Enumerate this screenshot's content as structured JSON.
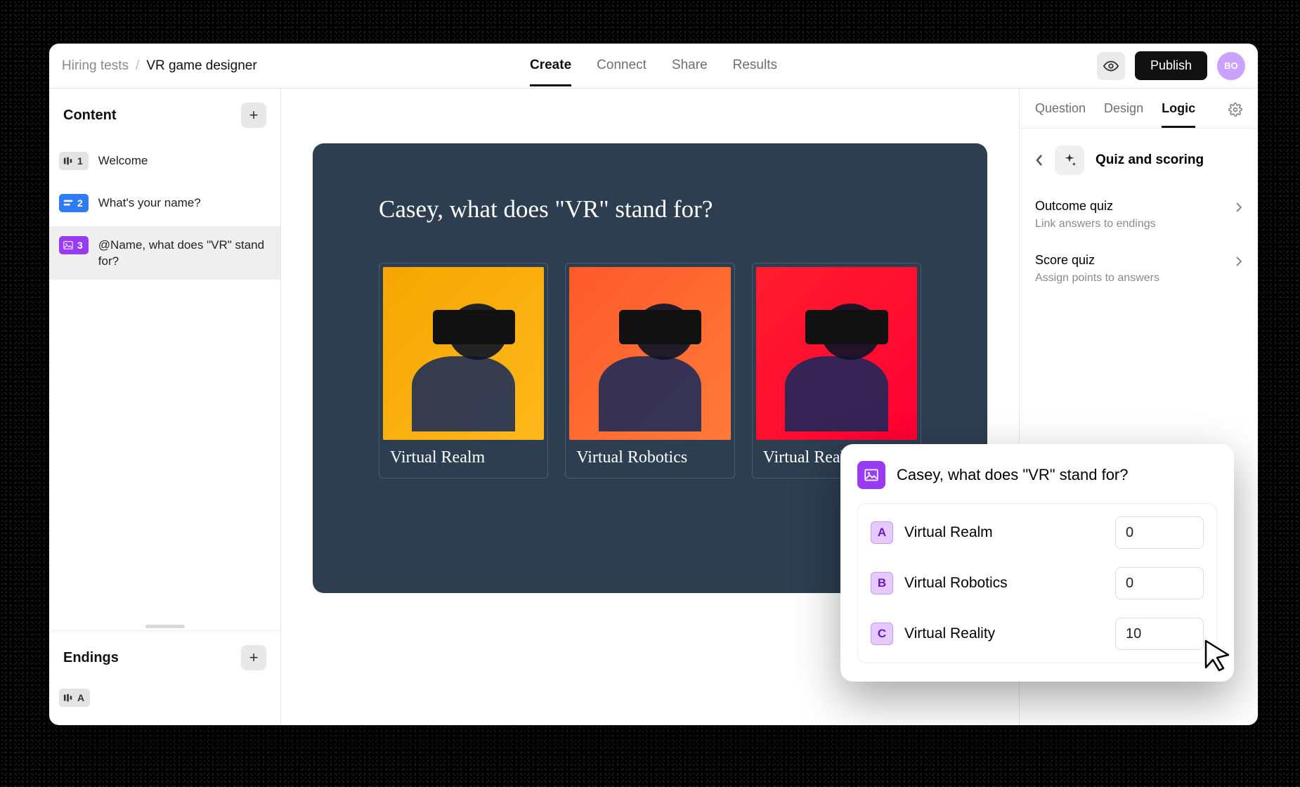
{
  "breadcrumb": {
    "parent": "Hiring tests",
    "current": "VR game designer"
  },
  "header": {
    "tabs": {
      "create": "Create",
      "connect": "Connect",
      "share": "Share",
      "results": "Results"
    },
    "active_tab": "Create",
    "publish": "Publish",
    "avatar_initials": "BO"
  },
  "sidebar": {
    "content_title": "Content",
    "endings_title": "Endings",
    "content": [
      {
        "number": "1",
        "label": "Welcome",
        "style": "gray",
        "icon": "welcome-icon"
      },
      {
        "number": "2",
        "label": "What's your name?",
        "style": "blue",
        "icon": "form-icon"
      },
      {
        "number": "3",
        "label": "@Name, what does \"VR\" stand for?",
        "style": "purple",
        "icon": "picture-icon"
      }
    ],
    "endings": [
      {
        "letter": "A"
      }
    ]
  },
  "canvas": {
    "question": "Casey, what does \"VR\" stand for?",
    "choices": [
      {
        "label": "Virtual Realm",
        "color": "yellow"
      },
      {
        "label": "Virtual Robotics",
        "color": "orange"
      },
      {
        "label": "Virtual Reality",
        "color": "red"
      }
    ]
  },
  "right_panel": {
    "tabs": {
      "question": "Question",
      "design": "Design",
      "logic": "Logic"
    },
    "active_tab": "Logic",
    "quiz_heading": "Quiz and scoring",
    "outcome": {
      "title": "Outcome quiz",
      "sub": "Link answers to endings"
    },
    "score": {
      "title": "Score quiz",
      "sub": "Assign points to answers"
    }
  },
  "popup": {
    "title": "Casey, what does \"VR\" stand for?",
    "answers": [
      {
        "letter": "A",
        "label": "Virtual Realm",
        "score": "0"
      },
      {
        "letter": "B",
        "label": "Virtual Robotics",
        "score": "0"
      },
      {
        "letter": "C",
        "label": "Virtual Reality",
        "score": "10"
      }
    ]
  },
  "colors": {
    "canvas_bg": "#2d3e50",
    "purple": "#9a3bf4",
    "blue": "#2f7af5"
  }
}
